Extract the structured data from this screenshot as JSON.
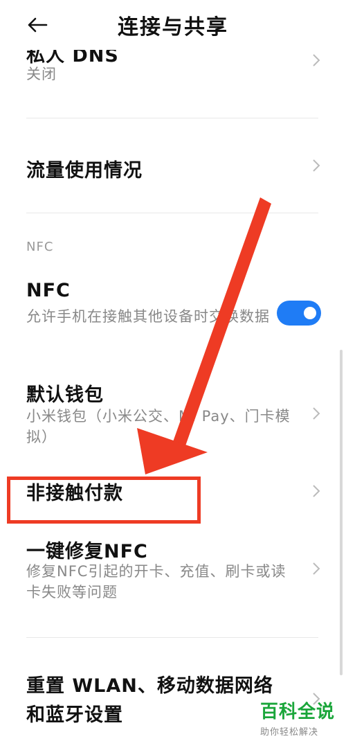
{
  "header": {
    "title": "连接与共享",
    "back_icon": "back-arrow-icon"
  },
  "items": {
    "private_dns": {
      "title": "私人 DNS",
      "subtitle": "关闭"
    },
    "data_usage": {
      "title": "流量使用情况"
    },
    "nfc_section": "NFC",
    "nfc": {
      "title": "NFC",
      "subtitle": "允许手机在接触其他设备时交换数据",
      "toggle_on": true,
      "toggle_color": "#1f7cf5"
    },
    "default_wallet": {
      "title": "默认钱包",
      "subtitle": "小米钱包（小米公交、Mi Pay、门卡模拟）"
    },
    "contactless_pay": {
      "title": "非接触付款"
    },
    "repair_nfc": {
      "title": "一键修复NFC",
      "subtitle": "修复NFC引起的开卡、充值、刷卡或读卡失败等问题"
    },
    "reset_network": {
      "title": "重置 WLAN、移动数据网络和蓝牙设置"
    }
  },
  "annotation": {
    "color": "#ee3b24"
  },
  "watermark": {
    "main": "百科全说",
    "sub": "助你轻松解决"
  }
}
